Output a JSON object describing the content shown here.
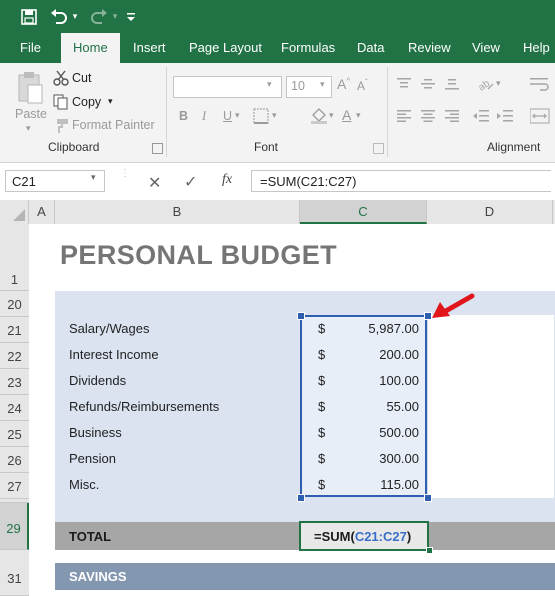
{
  "qat": {
    "save_icon": "save-icon",
    "undo_icon": "undo-icon",
    "redo_icon": "redo-icon",
    "customize_icon": "customize-icon"
  },
  "tabs": [
    {
      "label": "File"
    },
    {
      "label": "Home"
    },
    {
      "label": "Insert"
    },
    {
      "label": "Page Layout"
    },
    {
      "label": "Formulas"
    },
    {
      "label": "Data"
    },
    {
      "label": "Review"
    },
    {
      "label": "View"
    },
    {
      "label": "Help"
    }
  ],
  "ribbon": {
    "clipboard": {
      "paste": "Paste",
      "cut": "Cut",
      "copy": "Copy",
      "format_painter": "Format Painter",
      "group_label": "Clipboard"
    },
    "font": {
      "size": "10",
      "bold": "B",
      "italic": "I",
      "underline": "U",
      "group_label": "Font"
    },
    "alignment": {
      "group_label": "Alignment"
    }
  },
  "formula_bar": {
    "name_box": "C21",
    "fx": "fx",
    "formula": "=SUM(C21:C27)"
  },
  "columns": [
    "A",
    "B",
    "C",
    "D"
  ],
  "rows": [
    "1",
    "20",
    "21",
    "22",
    "23",
    "24",
    "25",
    "26",
    "27",
    "29",
    "31"
  ],
  "sheet": {
    "title": "PERSONAL BUDGET",
    "currency": "$",
    "income": [
      {
        "label": "Salary/Wages",
        "amount": "5,987.00"
      },
      {
        "label": "Interest Income",
        "amount": "200.00"
      },
      {
        "label": "Dividends",
        "amount": "100.00"
      },
      {
        "label": "Refunds/Reimbursements",
        "amount": "55.00"
      },
      {
        "label": "Business",
        "amount": "500.00"
      },
      {
        "label": "Pension",
        "amount": "300.00"
      },
      {
        "label": "Misc.",
        "amount": "115.00"
      }
    ],
    "total_label": "TOTAL",
    "total_formula_prefix": "=SUM(",
    "total_formula_ref": "C21:C27",
    "total_formula_suffix": ")",
    "savings_label": "SAVINGS"
  },
  "colors": {
    "excel_green": "#217346",
    "band_blue": "#dbe3f1",
    "total_grey": "#a6a6a6",
    "savings_blue": "#8497b0",
    "selection_blue": "#2e5fb0",
    "ref_blue": "#3a6fc9",
    "arrow_red": "#e0161b"
  }
}
